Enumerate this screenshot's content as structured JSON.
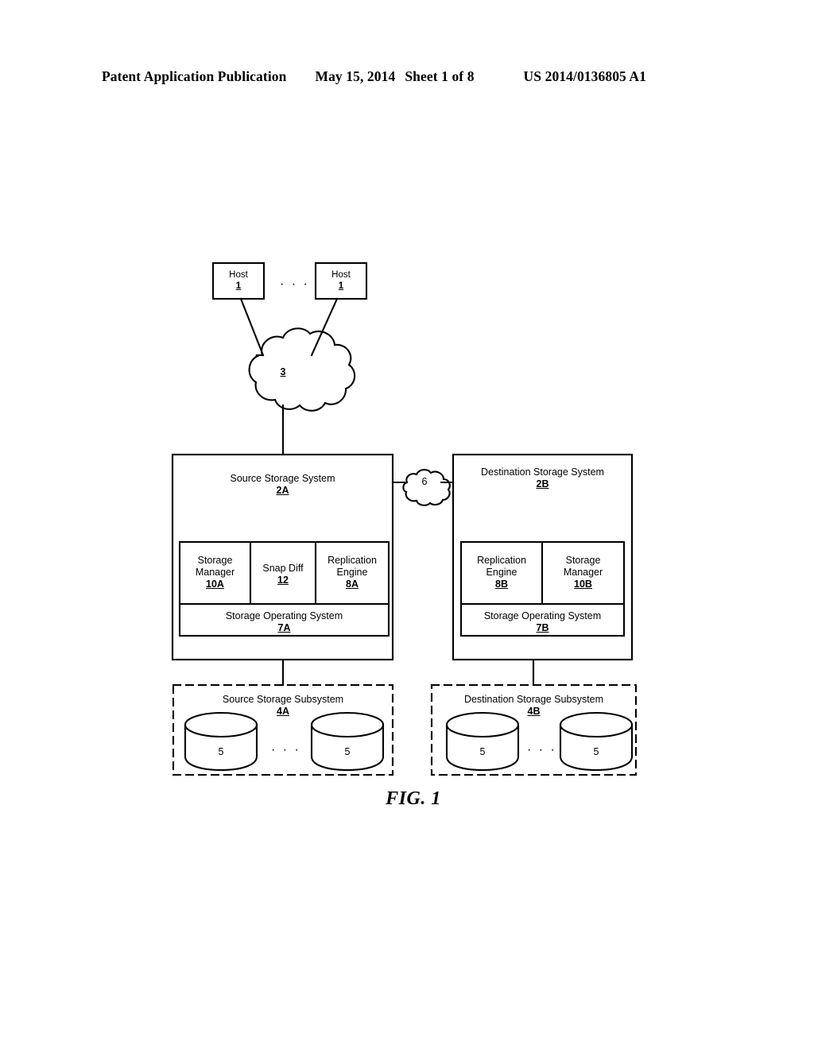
{
  "header": {
    "publication": "Patent Application Publication",
    "date": "May 15, 2014",
    "sheet": "Sheet 1 of 8",
    "patent_number": "US 2014/0136805 A1"
  },
  "figure": {
    "caption": "FIG. 1",
    "ellipsis": "· · ·",
    "hosts": [
      {
        "label": "Host",
        "ref": "1"
      },
      {
        "label": "Host",
        "ref": "1"
      }
    ],
    "network_cloud": {
      "ref": "3"
    },
    "interconnect_cloud": {
      "ref": "6"
    },
    "source_system": {
      "title": "Source Storage System",
      "ref": "2A",
      "modules": [
        {
          "line1": "Storage",
          "line2": "Manager",
          "ref": "10A"
        },
        {
          "line1": "Snap Diff",
          "line2": "",
          "ref": "12"
        },
        {
          "line1": "Replication",
          "line2": "Engine",
          "ref": "8A"
        }
      ],
      "operating_system": {
        "title": "Storage Operating System",
        "ref": "7A"
      }
    },
    "destination_system": {
      "title": "Destination Storage System",
      "ref": "2B",
      "modules": [
        {
          "line1": "Replication",
          "line2": "Engine",
          "ref": "8B"
        },
        {
          "line1": "Storage",
          "line2": "Manager",
          "ref": "10B"
        }
      ],
      "operating_system": {
        "title": "Storage Operating System",
        "ref": "7B"
      }
    },
    "source_subsystem": {
      "title": "Source Storage Subsystem",
      "ref": "4A",
      "disks": [
        {
          "ref": "5"
        },
        {
          "ref": "5"
        }
      ]
    },
    "destination_subsystem": {
      "title": "Destination Storage Subsystem",
      "ref": "4B",
      "disks": [
        {
          "ref": "5"
        },
        {
          "ref": "5"
        }
      ]
    }
  },
  "colors": {
    "ink": "#000000",
    "paper": "#ffffff"
  }
}
